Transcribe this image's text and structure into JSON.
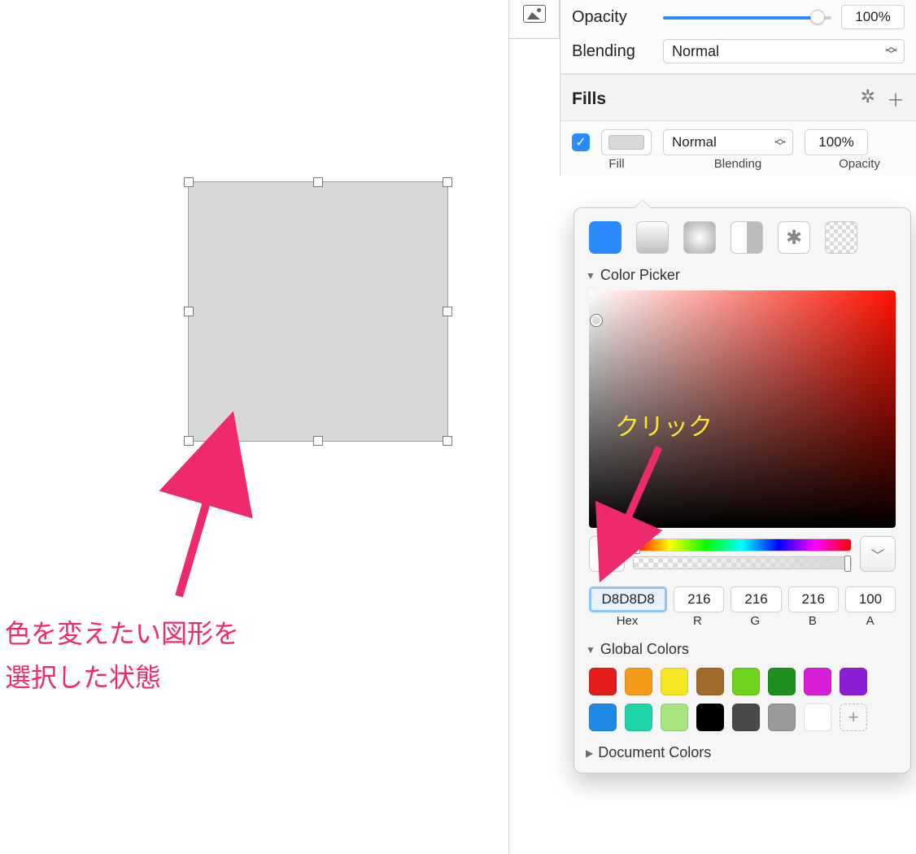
{
  "inspector": {
    "opacity_label": "Opacity",
    "opacity_value": "100%",
    "blending_label": "Blending",
    "blending_value": "Normal",
    "fills_header": "Fills",
    "fill_blend": "Normal",
    "fill_opacity": "100%",
    "sub_fill": "Fill",
    "sub_blend": "Blending",
    "sub_opacity": "Opacity"
  },
  "popover": {
    "color_picker": "Color Picker",
    "hex": "D8D8D8",
    "r": "216",
    "g": "216",
    "b": "216",
    "a": "100",
    "hex_label": "Hex",
    "r_label": "R",
    "g_label": "G",
    "b_label": "B",
    "a_label": "A",
    "global_colors": "Global Colors",
    "document_colors": "Document Colors"
  },
  "annotations": {
    "click": "クリック",
    "left1": "色を変えたい図形を",
    "left2": "選択した状態"
  },
  "global_swatches": [
    "#e51c1c",
    "#f59a1b",
    "#f6e723",
    "#a26a2a",
    "#6fd21d",
    "#1f8f1f",
    "#d61fd6",
    "#8a1fd6",
    "#1f8ae5",
    "#1fd6a8",
    "#a6e57f",
    "#000000",
    "#4a4a4a",
    "#9b9b9b",
    "#ffffff"
  ]
}
